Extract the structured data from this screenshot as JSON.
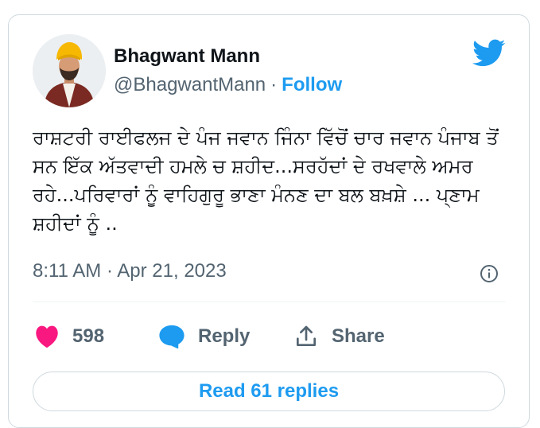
{
  "author": {
    "name": "Bhagwant Mann",
    "handle": "@BhagwantMann",
    "separator": "·",
    "follow_label": "Follow"
  },
  "tweet": {
    "text": "ਰਾਸ਼ਟਰੀ ਰਾਈਫਲਜ ਦੇ ਪੰਜ ਜਵਾਨ ਜਿੰਨਾ ਵਿੱਚੋਂ ਚਾਰ ਜਵਾਨ ਪੰਜਾਬ ਤੋਂ ਸਨ ਇੱਕ ਅੱਤਵਾਦੀ ਹਮਲੇ ਚ ਸ਼ਹੀਦ...ਸਰਹੱਦਾਂ ਦੇ ਰਖਵਾਲੇ ਅਮਰ ਰਹੇ...ਪਰਿਵਾਰਾਂ ਨੂੰ ਵਾਹਿਗੁਰੂ ਭਾਣਾ ਮੰਨਣ ਦਾ ਬਲ ਬਖ਼ਸ਼ੇ ... ਪ੍ਣਾਮ ਸ਼ਹੀਦਾਂ ਨੂੰ ..",
    "timestamp": "8:11 AM · Apr 21, 2023"
  },
  "actions": {
    "likes": "598",
    "reply_label": "Reply",
    "share_label": "Share"
  },
  "read_replies_label": "Read 61 replies",
  "icons": {
    "brand": "twitter-bird-icon",
    "info": "info-icon",
    "like": "heart-icon",
    "reply": "speech-bubble-icon",
    "share": "share-upload-icon"
  },
  "colors": {
    "accent": "#1d9bf0",
    "like": "#f91880",
    "muted": "#536471",
    "text": "#0f1419",
    "border": "#cfd9de"
  }
}
